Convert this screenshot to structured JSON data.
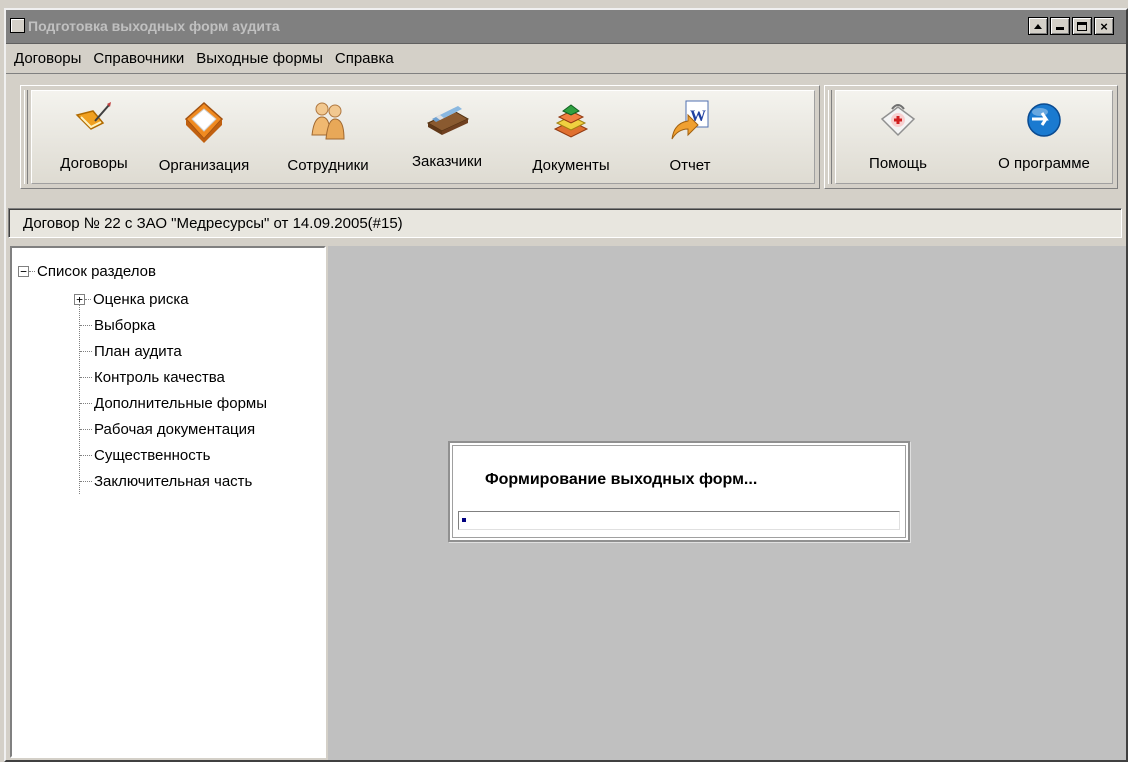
{
  "window": {
    "title": "Подготовка выходных форм аудита"
  },
  "menu": [
    {
      "label": "Договоры"
    },
    {
      "label": "Справочники"
    },
    {
      "label": "Выходные формы"
    },
    {
      "label": "Справка"
    }
  ],
  "toolbar": {
    "main": [
      {
        "label": "Договоры",
        "icon": "contract-check-icon"
      },
      {
        "label": "Организация",
        "icon": "house-icon"
      },
      {
        "label": "Сотрудники",
        "icon": "people-icon"
      },
      {
        "label": "Заказчики",
        "icon": "card-file-icon"
      },
      {
        "label": "Документы",
        "icon": "documents-stack-icon"
      },
      {
        "label": "Отчет",
        "icon": "word-report-icon"
      }
    ],
    "help": [
      {
        "label": "Помощь",
        "icon": "first-aid-icon"
      },
      {
        "label": "О программе",
        "icon": "info-globe-icon"
      }
    ]
  },
  "status": {
    "contract": "Договор № 22 с ЗАО \"Медресурсы\" от 14.09.2005(#15)"
  },
  "tree": {
    "root": "Список разделов",
    "items": [
      {
        "label": "Оценка риска",
        "expandable": true
      },
      {
        "label": "Выборка"
      },
      {
        "label": "План аудита"
      },
      {
        "label": "Контроль качества"
      },
      {
        "label": "Дополнительные формы"
      },
      {
        "label": "Рабочая документация"
      },
      {
        "label": "Существенность"
      },
      {
        "label": "Заключительная часть"
      }
    ]
  },
  "progress": {
    "title": "Формирование выходных форм...",
    "fraction": 0.01
  },
  "colors": {
    "accent": "#000080",
    "window_bg": "#d4d0c8",
    "workspace": "#c0c0c0"
  }
}
